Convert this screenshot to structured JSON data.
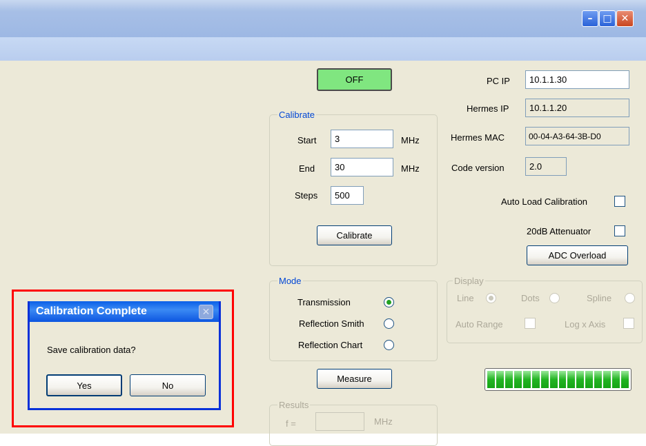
{
  "window": {
    "min_glyph": "–",
    "max_glyph": "□",
    "close_glyph": "✕"
  },
  "power_button": {
    "label": "OFF",
    "color": "#80e680"
  },
  "calibrate": {
    "group_label": "Calibrate",
    "start_label": "Start",
    "start_value": "3",
    "start_unit": "MHz",
    "end_label": "End",
    "end_value": "30",
    "end_unit": "MHz",
    "steps_label": "Steps",
    "steps_value": "500",
    "button_label": "Calibrate"
  },
  "network": {
    "pc_ip_label": "PC IP",
    "pc_ip_value": "10.1.1.30",
    "hermes_ip_label": "Hermes IP",
    "hermes_ip_value": "10.1.1.20",
    "hermes_mac_label": "Hermes MAC",
    "hermes_mac_value": "00-04-A3-64-3B-D0",
    "code_version_label": "Code version",
    "code_version_value": "2.0"
  },
  "options": {
    "auto_load_label": "Auto Load Calibration",
    "attenuator_label": "20dB Attenuator",
    "adc_button_label": "ADC Overload"
  },
  "mode": {
    "group_label": "Mode",
    "items": [
      {
        "label": "Transmission",
        "selected": true
      },
      {
        "label": "Reflection Smith",
        "selected": false
      },
      {
        "label": "Reflection Chart",
        "selected": false
      }
    ]
  },
  "display": {
    "group_label": "Display",
    "line_label": "Line",
    "dots_label": "Dots",
    "spline_label": "Spline",
    "auto_range_label": "Auto Range",
    "log_x_label": "Log x Axis"
  },
  "measure_button_label": "Measure",
  "results": {
    "group_label": "Results",
    "f_label": "f =",
    "f_value": "",
    "unit": "MHz"
  },
  "progress": {
    "fraction": 1.0,
    "segments": 16
  },
  "dialog": {
    "title": "Calibration Complete",
    "close_glyph": "✕",
    "message": "Save calibration data?",
    "yes_label": "Yes",
    "no_label": "No"
  }
}
